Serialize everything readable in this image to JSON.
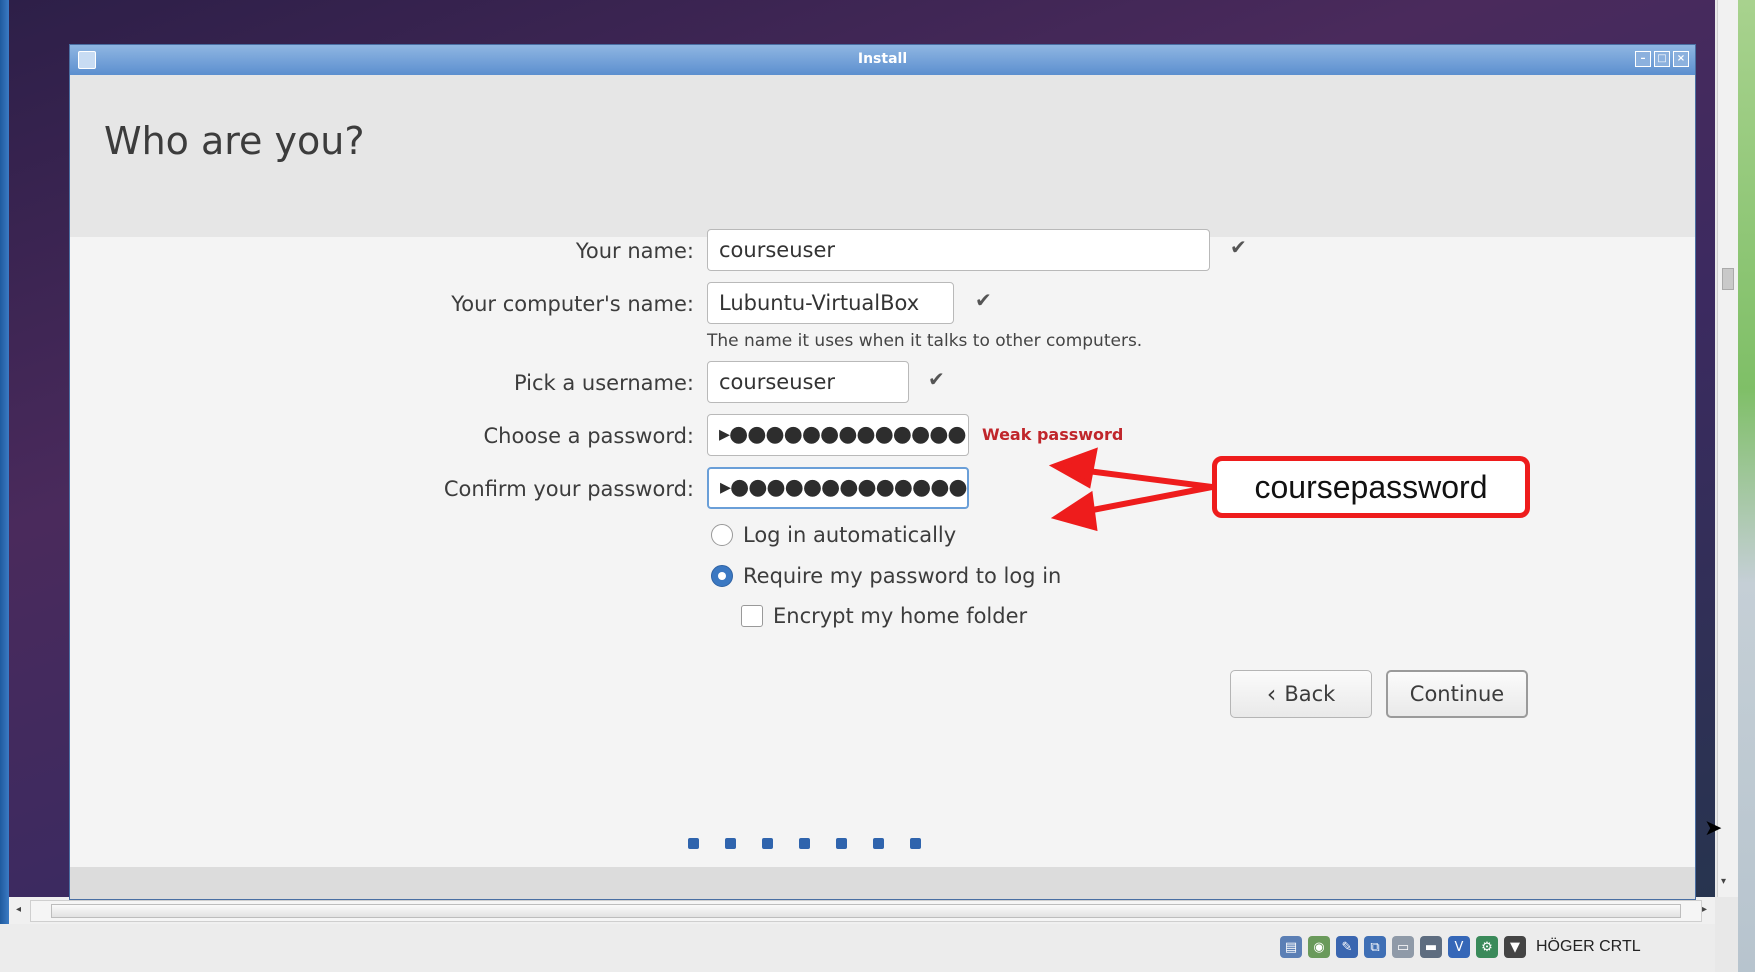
{
  "window": {
    "title": "Install"
  },
  "page": {
    "title": "Who are you?"
  },
  "form": {
    "your_name": {
      "label": "Your name:",
      "value": "courseuser"
    },
    "computer_name": {
      "label": "Your computer's name:",
      "value": "Lubuntu-VirtualBox",
      "helper": "The name it uses when it talks to other computers."
    },
    "username": {
      "label": "Pick a username:",
      "value": "courseuser"
    },
    "password": {
      "label": "Choose a password:",
      "value_masked": "▸●●●●●●●●●●●●●",
      "strength": "Weak password"
    },
    "confirm": {
      "label": "Confirm your password:",
      "value_masked": "▸●●●●●●●●●●●●●"
    },
    "login_options": [
      {
        "label": "Log in automatically",
        "selected": false
      },
      {
        "label": "Require my password to log in",
        "selected": true
      }
    ],
    "encrypt": {
      "label": "Encrypt my home folder",
      "checked": false
    }
  },
  "buttons": {
    "back": "Back",
    "continue": "Continue"
  },
  "progress": {
    "steps": 7
  },
  "annotation": {
    "text": "coursepassword",
    "color": "#ee1c1c"
  },
  "statusbar": {
    "host_key": "HÖGER CRTL"
  },
  "colors": {
    "accent": "#3b78c2",
    "warning": "#c0262b",
    "titlebar": "#5c8fcf"
  }
}
